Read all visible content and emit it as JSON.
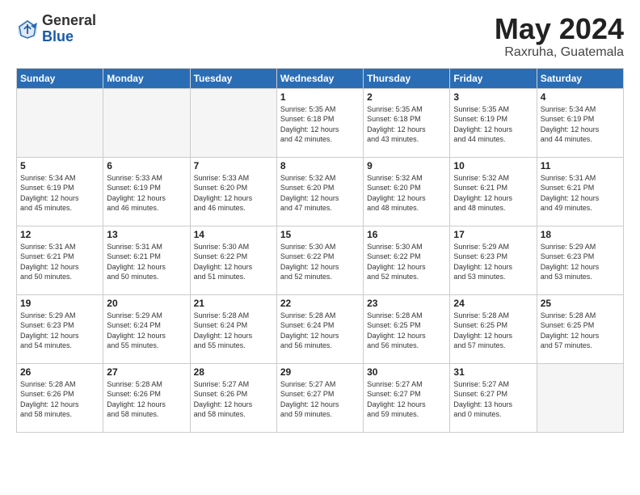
{
  "logo": {
    "general": "General",
    "blue": "Blue"
  },
  "title": "May 2024",
  "location": "Raxruha, Guatemala",
  "days_of_week": [
    "Sunday",
    "Monday",
    "Tuesday",
    "Wednesday",
    "Thursday",
    "Friday",
    "Saturday"
  ],
  "weeks": [
    [
      {
        "num": "",
        "info": ""
      },
      {
        "num": "",
        "info": ""
      },
      {
        "num": "",
        "info": ""
      },
      {
        "num": "1",
        "info": "Sunrise: 5:35 AM\nSunset: 6:18 PM\nDaylight: 12 hours\nand 42 minutes."
      },
      {
        "num": "2",
        "info": "Sunrise: 5:35 AM\nSunset: 6:18 PM\nDaylight: 12 hours\nand 43 minutes."
      },
      {
        "num": "3",
        "info": "Sunrise: 5:35 AM\nSunset: 6:19 PM\nDaylight: 12 hours\nand 44 minutes."
      },
      {
        "num": "4",
        "info": "Sunrise: 5:34 AM\nSunset: 6:19 PM\nDaylight: 12 hours\nand 44 minutes."
      }
    ],
    [
      {
        "num": "5",
        "info": "Sunrise: 5:34 AM\nSunset: 6:19 PM\nDaylight: 12 hours\nand 45 minutes."
      },
      {
        "num": "6",
        "info": "Sunrise: 5:33 AM\nSunset: 6:19 PM\nDaylight: 12 hours\nand 46 minutes."
      },
      {
        "num": "7",
        "info": "Sunrise: 5:33 AM\nSunset: 6:20 PM\nDaylight: 12 hours\nand 46 minutes."
      },
      {
        "num": "8",
        "info": "Sunrise: 5:32 AM\nSunset: 6:20 PM\nDaylight: 12 hours\nand 47 minutes."
      },
      {
        "num": "9",
        "info": "Sunrise: 5:32 AM\nSunset: 6:20 PM\nDaylight: 12 hours\nand 48 minutes."
      },
      {
        "num": "10",
        "info": "Sunrise: 5:32 AM\nSunset: 6:21 PM\nDaylight: 12 hours\nand 48 minutes."
      },
      {
        "num": "11",
        "info": "Sunrise: 5:31 AM\nSunset: 6:21 PM\nDaylight: 12 hours\nand 49 minutes."
      }
    ],
    [
      {
        "num": "12",
        "info": "Sunrise: 5:31 AM\nSunset: 6:21 PM\nDaylight: 12 hours\nand 50 minutes."
      },
      {
        "num": "13",
        "info": "Sunrise: 5:31 AM\nSunset: 6:21 PM\nDaylight: 12 hours\nand 50 minutes."
      },
      {
        "num": "14",
        "info": "Sunrise: 5:30 AM\nSunset: 6:22 PM\nDaylight: 12 hours\nand 51 minutes."
      },
      {
        "num": "15",
        "info": "Sunrise: 5:30 AM\nSunset: 6:22 PM\nDaylight: 12 hours\nand 52 minutes."
      },
      {
        "num": "16",
        "info": "Sunrise: 5:30 AM\nSunset: 6:22 PM\nDaylight: 12 hours\nand 52 minutes."
      },
      {
        "num": "17",
        "info": "Sunrise: 5:29 AM\nSunset: 6:23 PM\nDaylight: 12 hours\nand 53 minutes."
      },
      {
        "num": "18",
        "info": "Sunrise: 5:29 AM\nSunset: 6:23 PM\nDaylight: 12 hours\nand 53 minutes."
      }
    ],
    [
      {
        "num": "19",
        "info": "Sunrise: 5:29 AM\nSunset: 6:23 PM\nDaylight: 12 hours\nand 54 minutes."
      },
      {
        "num": "20",
        "info": "Sunrise: 5:29 AM\nSunset: 6:24 PM\nDaylight: 12 hours\nand 55 minutes."
      },
      {
        "num": "21",
        "info": "Sunrise: 5:28 AM\nSunset: 6:24 PM\nDaylight: 12 hours\nand 55 minutes."
      },
      {
        "num": "22",
        "info": "Sunrise: 5:28 AM\nSunset: 6:24 PM\nDaylight: 12 hours\nand 56 minutes."
      },
      {
        "num": "23",
        "info": "Sunrise: 5:28 AM\nSunset: 6:25 PM\nDaylight: 12 hours\nand 56 minutes."
      },
      {
        "num": "24",
        "info": "Sunrise: 5:28 AM\nSunset: 6:25 PM\nDaylight: 12 hours\nand 57 minutes."
      },
      {
        "num": "25",
        "info": "Sunrise: 5:28 AM\nSunset: 6:25 PM\nDaylight: 12 hours\nand 57 minutes."
      }
    ],
    [
      {
        "num": "26",
        "info": "Sunrise: 5:28 AM\nSunset: 6:26 PM\nDaylight: 12 hours\nand 58 minutes."
      },
      {
        "num": "27",
        "info": "Sunrise: 5:28 AM\nSunset: 6:26 PM\nDaylight: 12 hours\nand 58 minutes."
      },
      {
        "num": "28",
        "info": "Sunrise: 5:27 AM\nSunset: 6:26 PM\nDaylight: 12 hours\nand 58 minutes."
      },
      {
        "num": "29",
        "info": "Sunrise: 5:27 AM\nSunset: 6:27 PM\nDaylight: 12 hours\nand 59 minutes."
      },
      {
        "num": "30",
        "info": "Sunrise: 5:27 AM\nSunset: 6:27 PM\nDaylight: 12 hours\nand 59 minutes."
      },
      {
        "num": "31",
        "info": "Sunrise: 5:27 AM\nSunset: 6:27 PM\nDaylight: 13 hours\nand 0 minutes."
      },
      {
        "num": "",
        "info": ""
      }
    ]
  ]
}
